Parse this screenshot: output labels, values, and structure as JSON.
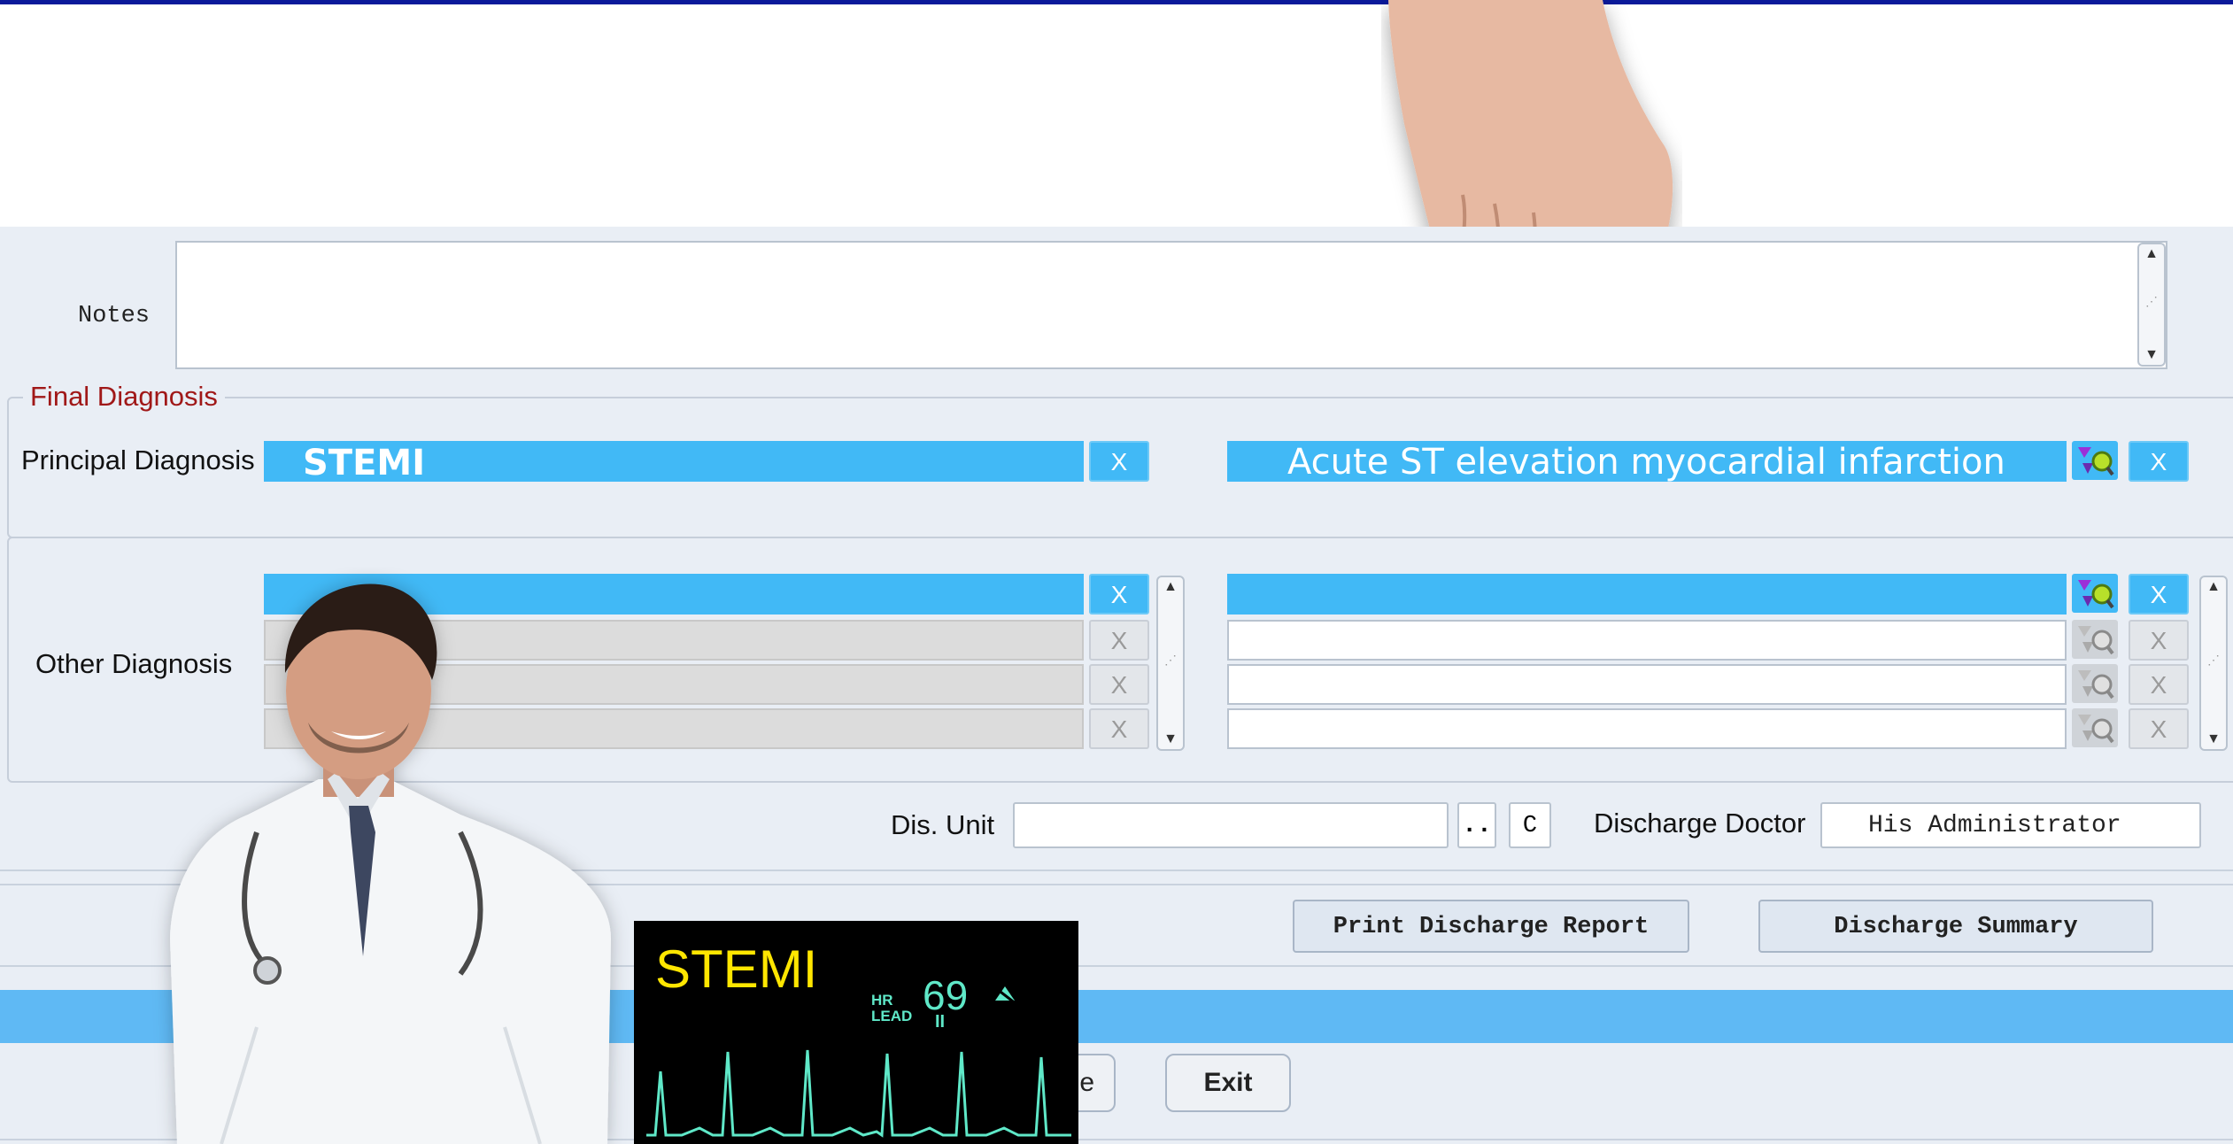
{
  "notes": {
    "label": "Notes",
    "value": ""
  },
  "final_diagnosis": {
    "legend": "Final Diagnosis",
    "principal_label": "Principal Diagnosis",
    "principal_code": "STEMI",
    "principal_description": "Acute ST elevation myocardial infarction",
    "clear_label": "X"
  },
  "other_diagnosis": {
    "label": "Other Diagnosis",
    "rows": [
      {
        "code": "",
        "description": "",
        "active": true
      },
      {
        "code": "",
        "description": "",
        "active": false
      },
      {
        "code": "",
        "description": "",
        "active": false
      },
      {
        "code": "",
        "description": "",
        "active": false
      }
    ]
  },
  "discharge": {
    "unit_label": "Dis. Unit",
    "unit_value": "",
    "lookup_label": "..",
    "clear_label": "C",
    "doctor_label": "Discharge Doctor",
    "doctor_value": "His Administrator"
  },
  "actions": {
    "print_report": "Print Discharge Report",
    "summary": "Discharge Summary",
    "partial_button": "e",
    "exit": "Exit"
  },
  "overlay": {
    "monitor_title": "STEMI",
    "hr_label": "HR",
    "lead_label": "LEAD",
    "hr_value": "69",
    "lead_value": "II"
  },
  "colors": {
    "accent": "#41b9f6",
    "legend": "#a01818",
    "topline": "#0b1a9a",
    "monitor_title": "#ffe600",
    "ecg": "#5fe8c8"
  }
}
